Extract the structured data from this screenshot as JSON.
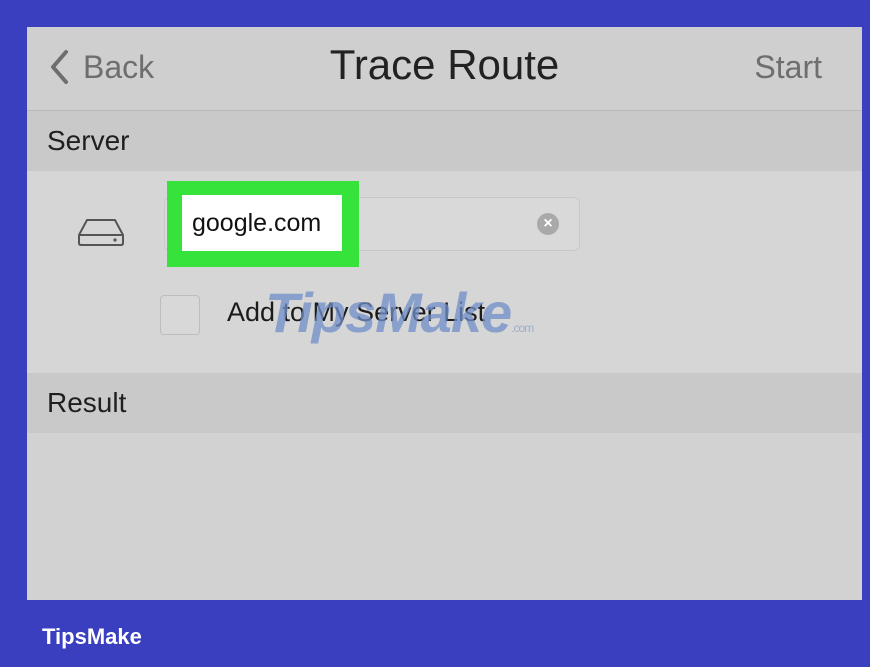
{
  "navbar": {
    "back_label": "Back",
    "title": "Trace Route",
    "start_label": "Start"
  },
  "server": {
    "heading": "Server",
    "input_value": "google.com",
    "checkbox_label": "Add to My Server List"
  },
  "result": {
    "heading": "Result"
  },
  "watermark": {
    "text": "TipsMake",
    "suffix": ".com"
  },
  "footer": {
    "brand": "TipsMake"
  },
  "colors": {
    "frame": "#3a3fbf",
    "highlight": "#36e33a",
    "screen_bg": "#d4d4d4"
  },
  "icons": [
    "chevron-left-icon",
    "drive-icon",
    "clear-icon"
  ]
}
